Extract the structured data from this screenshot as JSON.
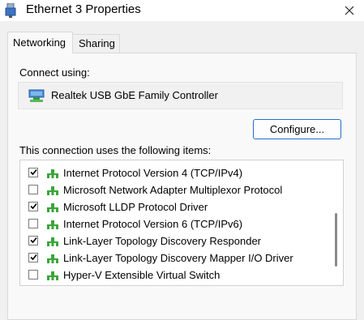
{
  "window": {
    "title": "Ethernet 3 Properties"
  },
  "tabs": [
    {
      "label": "Networking",
      "selected": true
    },
    {
      "label": "Sharing",
      "selected": false
    }
  ],
  "connect_using": {
    "label": "Connect using:",
    "adapter_name": "Realtek USB GbE Family Controller"
  },
  "configure_button": {
    "label": "Configure..."
  },
  "items_section": {
    "label": "This connection uses the following items:",
    "items": [
      {
        "label": "Internet Protocol Version 4 (TCP/IPv4)",
        "checked": true
      },
      {
        "label": "Microsoft Network Adapter Multiplexor Protocol",
        "checked": false
      },
      {
        "label": "Microsoft LLDP Protocol Driver",
        "checked": true
      },
      {
        "label": "Internet Protocol Version 6 (TCP/IPv6)",
        "checked": false
      },
      {
        "label": "Link-Layer Topology Discovery Responder",
        "checked": true
      },
      {
        "label": "Link-Layer Topology Discovery Mapper I/O Driver",
        "checked": true
      },
      {
        "label": "Hyper-V Extensible Virtual Switch",
        "checked": false
      }
    ]
  },
  "icons": {
    "window": "network-adapter-icon",
    "close": "close-icon",
    "adapter": "network-adapter-icon",
    "item": "protocol-icon",
    "check": "checkmark-icon"
  },
  "colors": {
    "accent": "#1f6fcf",
    "protocol_icon": "#3aa53a",
    "window_bg": "#f0f0f0"
  }
}
